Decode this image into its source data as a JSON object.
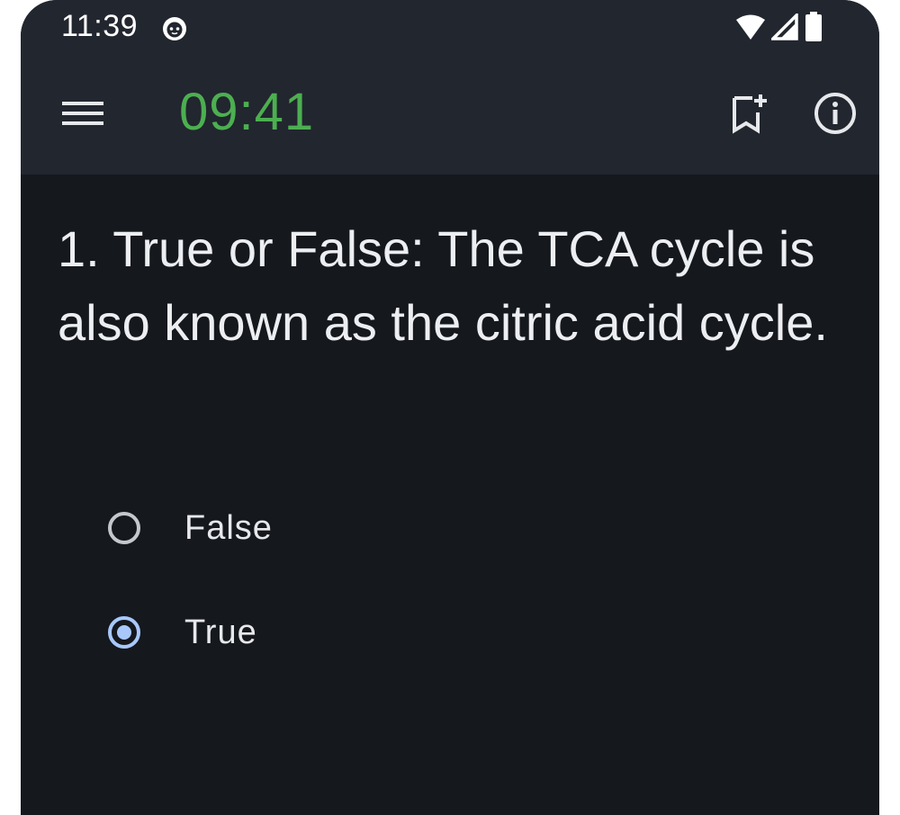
{
  "status_bar": {
    "time": "11:39",
    "icons": [
      "cat-notification-icon",
      "wifi-icon",
      "cellular-signal-icon",
      "battery-icon"
    ]
  },
  "app_bar": {
    "timer": "09:41",
    "timer_color": "#4caf50",
    "icons": [
      "menu-icon",
      "bookmark-add-icon",
      "info-icon"
    ]
  },
  "question": {
    "text": "1. True or False: The TCA cycle is also known as the citric acid cycle."
  },
  "options": [
    {
      "label": "False",
      "selected": false
    },
    {
      "label": "True",
      "selected": true
    }
  ],
  "colors": {
    "background": "#15181d",
    "app_bar": "#22262f",
    "radio_selected": "#a8c8fb",
    "radio_unselected": "#c4c7cc"
  }
}
